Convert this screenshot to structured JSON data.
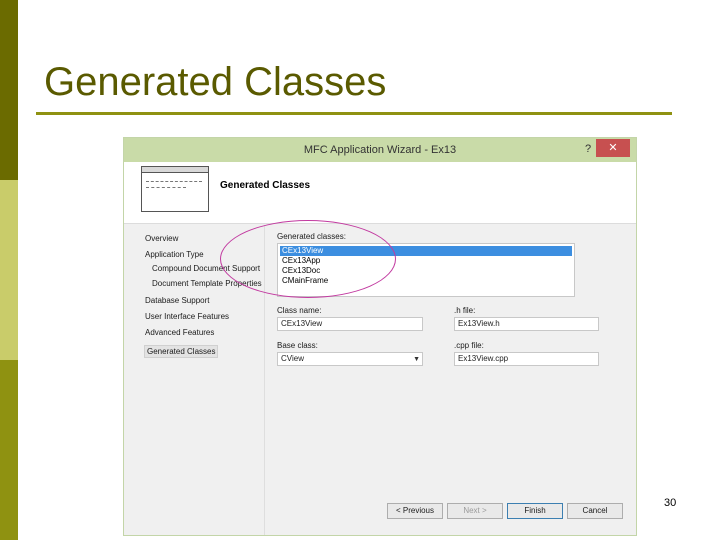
{
  "slide": {
    "title": "Generated Classes",
    "page_number": "30",
    "colors": {
      "bar_dark": "#6b6b00",
      "bar_light": "#c9cc6a",
      "bar_mid": "#8f9211",
      "title_text": "#5a5a00",
      "highlight": "#c23aa0"
    }
  },
  "dialog": {
    "title": "MFC Application Wizard - Ex13",
    "help_label": "?",
    "close_label": "✕",
    "page_heading": "Generated Classes",
    "nav": {
      "overview": "Overview",
      "application_type": "Application Type",
      "compound_document_support": "Compound Document Support",
      "document_template_properties": "Document Template Properties",
      "database_support": "Database Support",
      "user_interface_features": "User Interface Features",
      "advanced_features": "Advanced Features",
      "generated_classes": "Generated Classes"
    },
    "generated_classes_label": "Generated classes:",
    "classes": [
      "CEx13View",
      "CEx13App",
      "CEx13Doc",
      "CMainFrame"
    ],
    "selected_class": "CEx13View",
    "class_name_label": "Class name:",
    "class_name_value": "CEx13View",
    "h_file_label": ".h file:",
    "h_file_value": "Ex13View.h",
    "base_class_label": "Base class:",
    "base_class_value": "CView",
    "cpp_file_label": ".cpp file:",
    "cpp_file_value": "Ex13View.cpp",
    "buttons": {
      "previous": "< Previous",
      "next": "Next >",
      "finish": "Finish",
      "cancel": "Cancel"
    }
  }
}
